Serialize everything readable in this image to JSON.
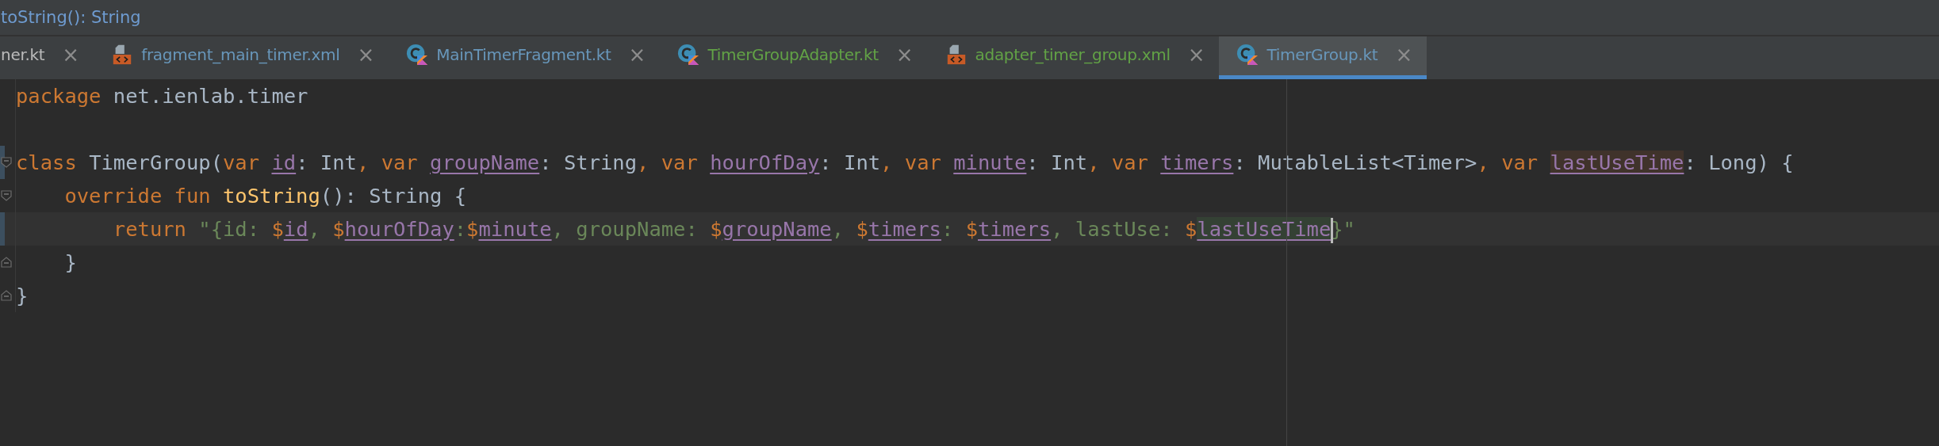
{
  "breadcrumb": {
    "text": "toString(): String"
  },
  "tabs": [
    {
      "label": "ner.kt",
      "kind": "plain",
      "close": "×",
      "color": "#bbbbbb",
      "selected": false
    },
    {
      "label": "fragment_main_timer.xml",
      "kind": "xml",
      "close": "×",
      "color": "#6897bb",
      "selected": false
    },
    {
      "label": "MainTimerFragment.kt",
      "kind": "kotlin",
      "close": "×",
      "color": "#6897bb",
      "selected": false
    },
    {
      "label": "TimerGroupAdapter.kt",
      "kind": "kotlin",
      "close": "×",
      "color": "#62a246",
      "selected": false
    },
    {
      "label": "adapter_timer_group.xml",
      "kind": "xml",
      "close": "×",
      "color": "#62a246",
      "selected": false
    },
    {
      "label": "TimerGroup.kt",
      "kind": "kotlin",
      "close": "×",
      "color": "#6897bb",
      "selected": true
    }
  ],
  "editor": {
    "lines": [
      {
        "kind": "plain",
        "changed": false,
        "current": false,
        "tokens": [
          {
            "kind": "keyword",
            "text": "package "
          },
          {
            "kind": "plain",
            "text": "net.ienlab.timer"
          }
        ]
      },
      {
        "kind": "blank",
        "changed": false,
        "current": false
      },
      {
        "kind": "fold-start",
        "changed": true,
        "current": false,
        "tokens": [
          {
            "kind": "keyword",
            "text": "class "
          },
          {
            "kind": "plain",
            "text": "TimerGroup("
          },
          {
            "kind": "keyword",
            "text": "var "
          },
          {
            "kind": "property",
            "text": "id"
          },
          {
            "kind": "plain",
            "text": ": Int"
          },
          {
            "kind": "keyword",
            "text": ", var "
          },
          {
            "kind": "property",
            "text": "groupName"
          },
          {
            "kind": "plain",
            "text": ": String"
          },
          {
            "kind": "keyword",
            "text": ", var "
          },
          {
            "kind": "property",
            "text": "hourOfDay"
          },
          {
            "kind": "plain",
            "text": ": Int"
          },
          {
            "kind": "keyword",
            "text": ", var "
          },
          {
            "kind": "property",
            "text": "minute"
          },
          {
            "kind": "plain",
            "text": ": Int"
          },
          {
            "kind": "keyword",
            "text": ", var "
          },
          {
            "kind": "property",
            "text": "timers"
          },
          {
            "kind": "plain",
            "text": ": MutableList<Timer>"
          },
          {
            "kind": "keyword",
            "text": ", var "
          },
          {
            "kind": "property-write",
            "text": "lastUseTime"
          },
          {
            "kind": "plain",
            "text": ": Long) {"
          }
        ]
      },
      {
        "kind": "fold-start",
        "changed": false,
        "current": false,
        "tokens": [
          {
            "kind": "keyword",
            "text": "    override fun "
          },
          {
            "kind": "function",
            "text": "toString"
          },
          {
            "kind": "plain",
            "text": "(): String {"
          }
        ]
      },
      {
        "kind": "plain",
        "changed": true,
        "current": true,
        "tokens": [
          {
            "kind": "keyword",
            "text": "        return "
          },
          {
            "kind": "string",
            "text": "\"{id: "
          },
          {
            "kind": "template",
            "text": "$"
          },
          {
            "kind": "property",
            "text": "id"
          },
          {
            "kind": "string",
            "text": ", "
          },
          {
            "kind": "template",
            "text": "$"
          },
          {
            "kind": "property",
            "text": "hourOfDay"
          },
          {
            "kind": "string",
            "text": ":"
          },
          {
            "kind": "template",
            "text": "$"
          },
          {
            "kind": "property",
            "text": "minute"
          },
          {
            "kind": "string",
            "text": ", groupName: "
          },
          {
            "kind": "template",
            "text": "$"
          },
          {
            "kind": "property",
            "text": "groupName"
          },
          {
            "kind": "string",
            "text": ", "
          },
          {
            "kind": "template",
            "text": "$"
          },
          {
            "kind": "property",
            "text": "timers"
          },
          {
            "kind": "string",
            "text": ": "
          },
          {
            "kind": "template",
            "text": "$"
          },
          {
            "kind": "property",
            "text": "timers"
          },
          {
            "kind": "string",
            "text": ", lastUse: "
          },
          {
            "kind": "template",
            "text": "$"
          },
          {
            "kind": "property-read",
            "text": "lastUseTime",
            "caret": true
          },
          {
            "kind": "string",
            "text": "}\""
          }
        ]
      },
      {
        "kind": "fold-end",
        "changed": false,
        "current": false,
        "tokens": [
          {
            "kind": "plain",
            "text": "    }"
          }
        ]
      },
      {
        "kind": "fold-end",
        "changed": false,
        "current": false,
        "tokens": [
          {
            "kind": "plain",
            "text": "}"
          }
        ]
      }
    ]
  }
}
